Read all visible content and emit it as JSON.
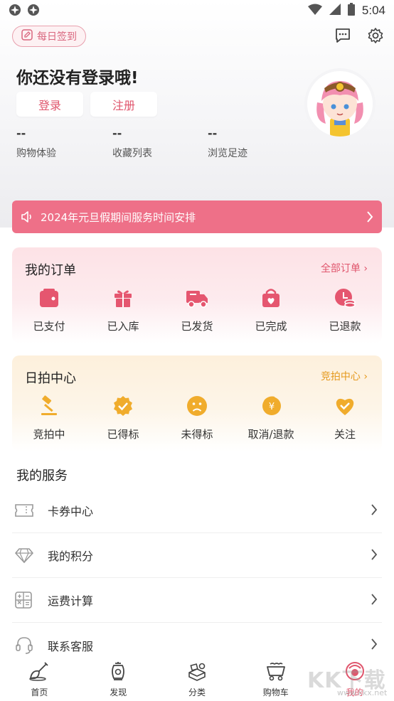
{
  "status_bar": {
    "time": "5:04"
  },
  "header": {
    "checkin_label": "每日签到"
  },
  "profile": {
    "greeting": "你还没有登录哦!",
    "login_label": "登录",
    "register_label": "注册",
    "stats": [
      {
        "value": "--",
        "label": "购物体验"
      },
      {
        "value": "--",
        "label": "收藏列表"
      },
      {
        "value": "--",
        "label": "浏览足迹"
      }
    ]
  },
  "notice": {
    "text": "2024年元旦假期间服务时间安排"
  },
  "orders": {
    "title": "我的订单",
    "link": "全部订单 ›",
    "items": [
      {
        "label": "已支付",
        "icon": "wallet-icon"
      },
      {
        "label": "已入库",
        "icon": "gift-icon"
      },
      {
        "label": "已发货",
        "icon": "truck-icon"
      },
      {
        "label": "已完成",
        "icon": "bag-icon"
      },
      {
        "label": "已退款",
        "icon": "refund-icon"
      }
    ]
  },
  "auction": {
    "title": "日拍中心",
    "link": "竞拍中心 ›",
    "items": [
      {
        "label": "竞拍中",
        "icon": "gavel-icon"
      },
      {
        "label": "已得标",
        "icon": "check-badge-icon"
      },
      {
        "label": "未得标",
        "icon": "sad-face-icon"
      },
      {
        "label": "取消/退款",
        "icon": "yen-coin-icon"
      },
      {
        "label": "关注",
        "icon": "heart-check-icon"
      }
    ]
  },
  "services": {
    "title": "我的服务",
    "items": [
      {
        "label": "卡券中心",
        "icon": "coupon-icon"
      },
      {
        "label": "我的积分",
        "icon": "diamond-icon"
      },
      {
        "label": "运费计算",
        "icon": "calculator-icon"
      },
      {
        "label": "联系客服",
        "icon": "headset-icon"
      }
    ]
  },
  "tabbar": {
    "items": [
      {
        "label": "首页",
        "icon": "shovel-icon"
      },
      {
        "label": "发现",
        "icon": "lantern-icon"
      },
      {
        "label": "分类",
        "icon": "boxes-icon"
      },
      {
        "label": "购物车",
        "icon": "cart-icon"
      },
      {
        "label": "我的",
        "icon": "profile-icon"
      }
    ],
    "active_index": 4
  },
  "watermark": {
    "text": "KK下载",
    "sub": "www.kkx.net"
  },
  "colors": {
    "accent": "#e0566d",
    "notice": "#ee7088",
    "gold": "#f0ac2c",
    "order_icon": "#e5566f"
  }
}
